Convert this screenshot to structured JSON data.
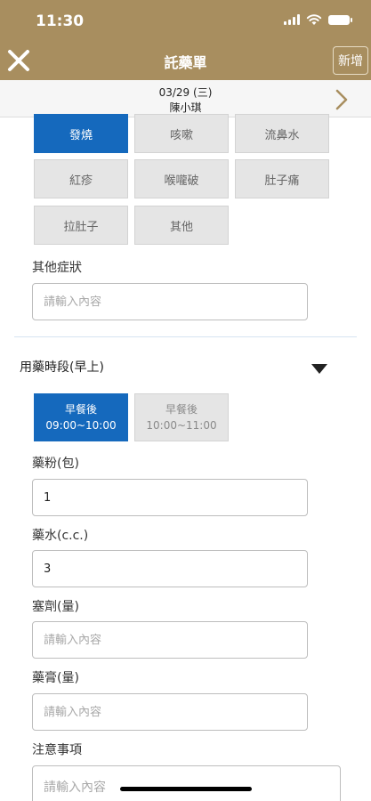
{
  "status_bar": {
    "time": "11:30"
  },
  "header": {
    "title": "託藥單",
    "add_label": "新增"
  },
  "date_bar": {
    "date": "03/29 (三)",
    "name": "陳小琪"
  },
  "symptoms": {
    "items": [
      {
        "label": "發燒",
        "selected": true
      },
      {
        "label": "咳嗽",
        "selected": false
      },
      {
        "label": "流鼻水",
        "selected": false
      },
      {
        "label": "紅疹",
        "selected": false
      },
      {
        "label": "喉嚨破",
        "selected": false
      },
      {
        "label": "肚子痛",
        "selected": false
      },
      {
        "label": "拉肚子",
        "selected": false
      },
      {
        "label": "其他",
        "selected": false
      }
    ],
    "other_label": "其他症狀",
    "other_placeholder": "請輸入內容"
  },
  "medication": {
    "section_title": "用藥時段(早上)",
    "time_options": [
      {
        "label": "早餐後",
        "time": "09:00~10:00",
        "selected": true
      },
      {
        "label": "早餐後",
        "time": "10:00~11:00",
        "selected": false
      }
    ],
    "powder": {
      "label": "藥粉(包)",
      "value": "1"
    },
    "syrup": {
      "label": "藥水(c.c.)",
      "value": "3"
    },
    "suppository": {
      "label": "塞劑(量)",
      "placeholder": "請輸入內容"
    },
    "ointment": {
      "label": "藥膏(量)",
      "placeholder": "請輸入內容"
    },
    "notes": {
      "label": "注意事項",
      "placeholder": "請輸入內容"
    }
  },
  "colors": {
    "header": "#a88e5f",
    "accent": "#1569bd",
    "unselected": "#e5e5e5"
  }
}
